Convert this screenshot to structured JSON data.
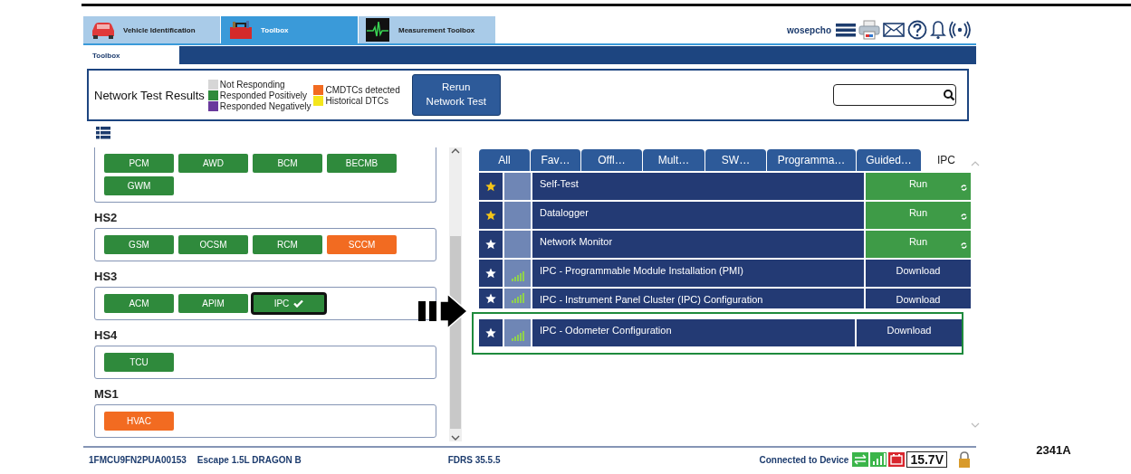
{
  "header_tabs": [
    {
      "label": "Vehicle Identification",
      "kind": "car",
      "selected": false
    },
    {
      "label": "Toolbox",
      "kind": "toolbox",
      "selected": true
    },
    {
      "label": "Measurement Toolbox",
      "kind": "scope",
      "selected": false
    }
  ],
  "user": "wosepcho",
  "sub_tabs": [
    {
      "label": "Toolbox",
      "selected": true
    }
  ],
  "network_test": {
    "title": "Network Test Results",
    "legend": [
      {
        "label": "Not Responding",
        "color": "#d6d6d6"
      },
      {
        "label": "Responded Positively",
        "color": "#2f8a3c"
      },
      {
        "label": "Responded Negatively",
        "color": "#6a3a9c"
      },
      {
        "label": "CMDTCs detected",
        "color": "#f26b21"
      },
      {
        "label": "Historical DTCs",
        "color": "#f4e61c"
      }
    ],
    "rerun_button": "Rerun Network Test"
  },
  "module_groups": [
    {
      "modules": [
        {
          "label": "PCM",
          "color": "#2f8a3c",
          "selected": false
        },
        {
          "label": "AWD",
          "color": "#2f8a3c",
          "selected": false
        },
        {
          "label": "BCM",
          "color": "#2f8a3c",
          "selected": false
        },
        {
          "label": "BECMB",
          "color": "#2f8a3c",
          "selected": false
        },
        {
          "label": "GWM",
          "color": "#2f8a3c",
          "selected": false
        }
      ]
    },
    {
      "title": "HS2",
      "modules": [
        {
          "label": "GSM",
          "color": "#2f8a3c",
          "selected": false
        },
        {
          "label": "OCSM",
          "color": "#2f8a3c",
          "selected": false
        },
        {
          "label": "RCM",
          "color": "#2f8a3c",
          "selected": false
        },
        {
          "label": "SCCM",
          "color": "#f26b21",
          "selected": false
        }
      ]
    },
    {
      "title": "HS3",
      "modules": [
        {
          "label": "ACM",
          "color": "#2f8a3c",
          "selected": false
        },
        {
          "label": "APIM",
          "color": "#2f8a3c",
          "selected": false
        },
        {
          "label": "IPC",
          "color": "#2f8a3c",
          "selected": true
        }
      ]
    },
    {
      "title": "HS4",
      "modules": [
        {
          "label": "TCU",
          "color": "#2f8a3c",
          "selected": false
        }
      ]
    },
    {
      "title": "MS1",
      "modules": [
        {
          "label": "HVAC",
          "color": "#f26b21",
          "selected": false
        }
      ]
    }
  ],
  "tool_tabs": [
    {
      "label": "All",
      "selected": false
    },
    {
      "label": "Fav…",
      "selected": false
    },
    {
      "label": "Offl…",
      "selected": false
    },
    {
      "label": "Mult…",
      "selected": false
    },
    {
      "label": "SW…",
      "selected": false
    },
    {
      "label": "Programma…",
      "selected": false
    },
    {
      "label": "Guided…",
      "selected": false
    },
    {
      "label": "IPC",
      "selected": true
    }
  ],
  "tools": [
    {
      "name": "Self-Test",
      "favorite": true,
      "signal": false,
      "action": "Run",
      "kind": "run",
      "highlighted": false
    },
    {
      "name": "Datalogger",
      "favorite": true,
      "signal": false,
      "action": "Run",
      "kind": "run",
      "highlighted": false
    },
    {
      "name": "Network Monitor",
      "favorite": false,
      "signal": false,
      "action": "Run",
      "kind": "run",
      "highlighted": false
    },
    {
      "name": "IPC - Programmable Module Installation (PMI)",
      "favorite": false,
      "signal": true,
      "action": "Download",
      "kind": "download",
      "highlighted": false
    },
    {
      "name": "IPC - Instrument Panel Cluster (IPC) Configuration",
      "favorite": false,
      "signal": true,
      "action": "Download",
      "kind": "download",
      "highlighted": false
    },
    {
      "name": "IPC - Odometer Configuration",
      "favorite": false,
      "signal": true,
      "action": "Download",
      "kind": "download",
      "highlighted": true
    }
  ],
  "status_bar": {
    "vin": "1FMCU9FN2PUA00153",
    "vehicle": "Escape 1.5L DRAGON B",
    "version": "FDRS 35.5.5",
    "connection": "Connected to Device",
    "voltage": "15.7V"
  },
  "figure_label": "2341A"
}
